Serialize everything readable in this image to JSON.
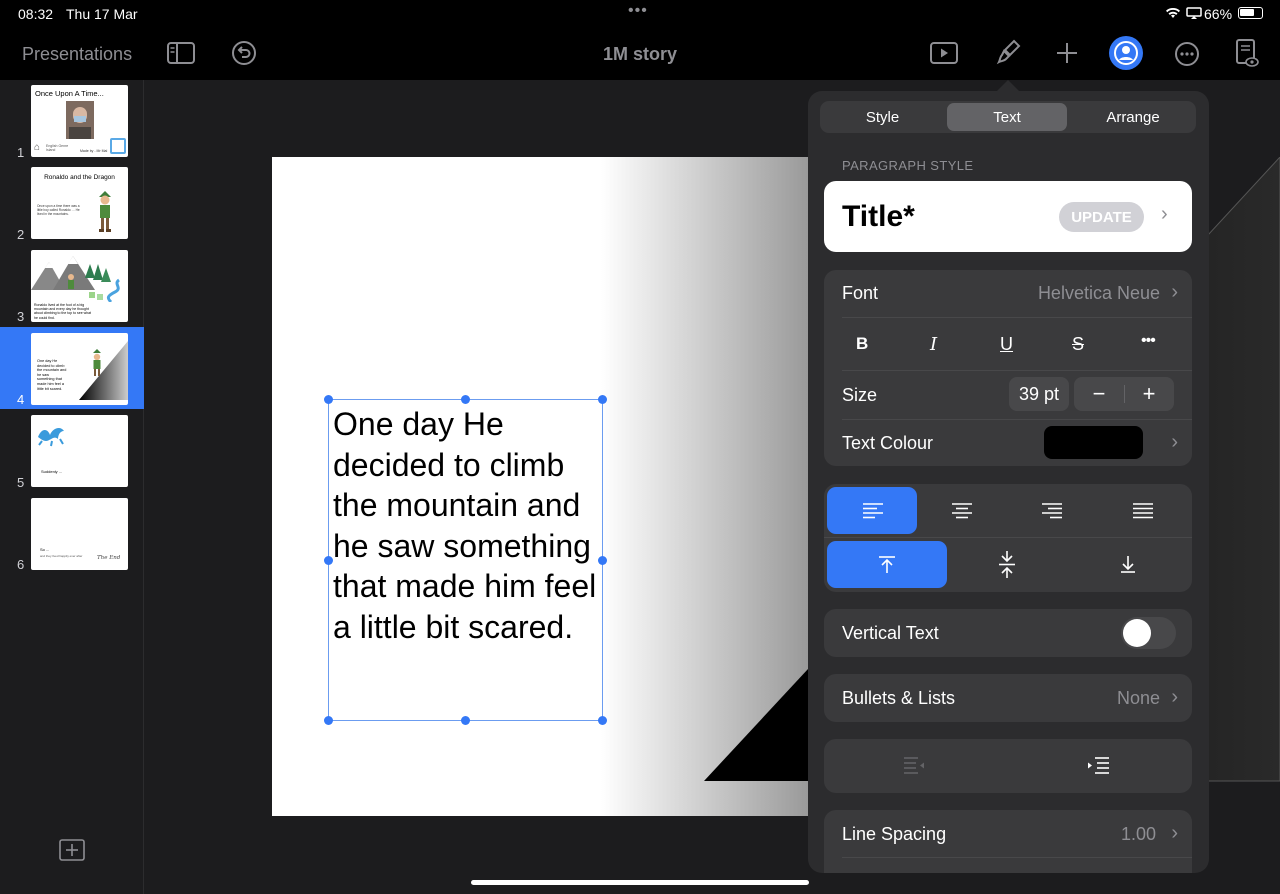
{
  "status": {
    "time": "08:32",
    "date": "Thu 17 Mar",
    "battery": "66%"
  },
  "toolbar": {
    "back_label": "Presentations",
    "doc_title": "1M story"
  },
  "slides": [
    {
      "num": "1",
      "title": "Once Upon A Time...",
      "footer_left": "English Genre Island",
      "footer_right": "Made by - Mr Mal"
    },
    {
      "num": "2",
      "title": "Ronaldo and the Dragon",
      "body": "Once upon a time there was a little boy called Ronaldo … He lived in the mountains."
    },
    {
      "num": "3",
      "body": "Ronaldo lived at the foot of a big mountain and every day he thought about climbing to the top to see what he could find."
    },
    {
      "num": "4",
      "body": "One day He decided to climb the mountain and he saw something that made him feel a little bit scared."
    },
    {
      "num": "5",
      "body": "Suddenly ..."
    },
    {
      "num": "6",
      "body": "So ...",
      "sub": "and they lived happily ever after",
      "signature": "The End"
    }
  ],
  "canvas_text": "One day He decided to climb the mountain and he saw something that made him feel a little bit scared.",
  "panel": {
    "tabs": [
      "Style",
      "Text",
      "Arrange"
    ],
    "active_tab": "Text",
    "paragraph_style_heading": "PARAGRAPH STYLE",
    "paragraph_style": "Title*",
    "update_label": "UPDATE",
    "font_label": "Font",
    "font_value": "Helvetica Neue",
    "format_buttons": [
      "B",
      "I",
      "U",
      "S",
      "•••"
    ],
    "size_label": "Size",
    "size_value": "39 pt",
    "minus": "−",
    "plus": "+",
    "text_colour_label": "Text Colour",
    "text_colour": "#000000",
    "vertical_text_label": "Vertical Text",
    "bullets_label": "Bullets & Lists",
    "bullets_value": "None",
    "line_spacing_label": "Line Spacing",
    "line_spacing_value": "1.00"
  },
  "colors": {
    "accent": "#3478f6",
    "panel": "#2c2c2e",
    "card": "#3a3a3c"
  }
}
